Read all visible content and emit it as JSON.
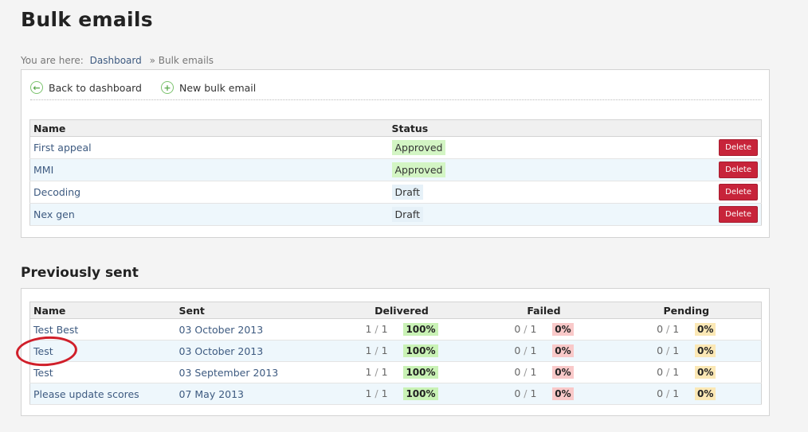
{
  "page": {
    "title": "Bulk emails"
  },
  "breadcrumb": {
    "prefix": "You are here:",
    "link": "Dashboard",
    "sep": "»",
    "current": "Bulk emails"
  },
  "toolbar": {
    "back": "Back to dashboard",
    "new": "New bulk email"
  },
  "drafts": {
    "headers": {
      "name": "Name",
      "status": "Status"
    },
    "rows": [
      {
        "name": "First appeal",
        "status": "Approved",
        "action": "Delete"
      },
      {
        "name": "MMI",
        "status": "Approved",
        "action": "Delete"
      },
      {
        "name": "Decoding",
        "status": "Draft",
        "action": "Delete"
      },
      {
        "name": "Nex gen",
        "status": "Draft",
        "action": "Delete"
      }
    ]
  },
  "sent": {
    "title": "Previously sent",
    "headers": {
      "name": "Name",
      "sent": "Sent",
      "delivered": "Delivered",
      "failed": "Failed",
      "pending": "Pending"
    },
    "rows": [
      {
        "name": "Test Best",
        "sent": "03 October 2013",
        "del_n": "1",
        "del_d": "1",
        "del_p": "100%",
        "fail_n": "0",
        "fail_d": "1",
        "fail_p": "0%",
        "pend_n": "0",
        "pend_d": "1",
        "pend_p": "0%"
      },
      {
        "name": "Test",
        "sent": "03 October 2013",
        "del_n": "1",
        "del_d": "1",
        "del_p": "100%",
        "fail_n": "0",
        "fail_d": "1",
        "fail_p": "0%",
        "pend_n": "0",
        "pend_d": "1",
        "pend_p": "0%"
      },
      {
        "name": "Test",
        "sent": "03 September 2013",
        "del_n": "1",
        "del_d": "1",
        "del_p": "100%",
        "fail_n": "0",
        "fail_d": "1",
        "fail_p": "0%",
        "pend_n": "0",
        "pend_d": "1",
        "pend_p": "0%"
      },
      {
        "name": "Please update scores",
        "sent": "07 May 2013",
        "del_n": "1",
        "del_d": "1",
        "del_p": "100%",
        "fail_n": "0",
        "fail_d": "1",
        "fail_p": "0%",
        "pend_n": "0",
        "pend_d": "1",
        "pend_p": "0%"
      }
    ]
  },
  "colors": {
    "approved": "#d3f5c4",
    "draft": "#e6f1f8",
    "delete": "#c7243a",
    "delivered": "#c9f2b5",
    "failed": "#f9c9c9",
    "pending": "#fbe8b5",
    "annotation": "#d01f2a"
  },
  "icons": {
    "back": "arrow-left-circle-icon",
    "new": "plus-circle-icon"
  }
}
